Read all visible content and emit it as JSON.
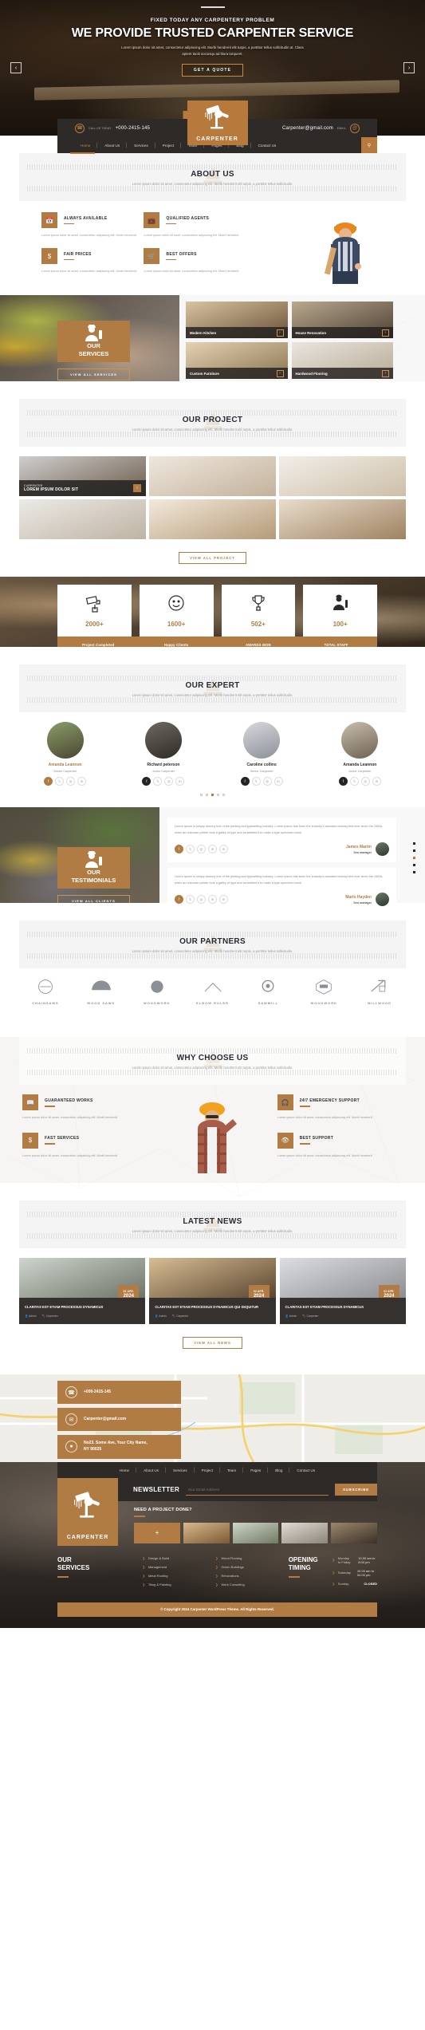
{
  "hero": {
    "subtitle": "FIXED TODAY ANY CARPENTERY PROBLEM",
    "title": "WE PROVIDE TRUSTED CARPENTER SERVICE",
    "description": "Lorem ipsum dolor sit amet, consectetur adipiscing elit. Morbi hendrerit elit turpis, a porttitor tellus sollicitudin at. Class aptent taciti sociosqu ad litora torquent.",
    "cta": "GET A QUOTE",
    "prev": "‹",
    "next": "›"
  },
  "topbar": {
    "phone_label": "CALL US TODAY",
    "phone": "+000-2415-145",
    "email": "Carpenter@gmail.com",
    "email_label": "EMAIL"
  },
  "logo": {
    "name": "CARPENTER"
  },
  "nav": {
    "items": [
      {
        "label": "Home",
        "active": true
      },
      {
        "label": "About Us",
        "active": false
      },
      {
        "label": "Services",
        "active": false
      },
      {
        "label": "Project",
        "active": false
      },
      {
        "label": "Team",
        "active": false
      },
      {
        "label": "Pages",
        "active": false
      },
      {
        "label": "Blog",
        "active": false
      },
      {
        "label": "Contact Us",
        "active": false
      }
    ],
    "search_icon": "search-icon"
  },
  "about": {
    "title": "ABOUT US",
    "subtitle": "Lorem ipsum dolor sit amet, consectetur adipiscing elit. Morbi hendrerit elit turpis, a porttitor tellus sollicitudin.",
    "features": [
      {
        "title": "ALWAYS AVAILABLE",
        "text": "Lorem ipsum dolor sit amet, consectetur adipiscing elit. Morbi hendrerit.",
        "icon": "calendar-icon"
      },
      {
        "title": "QUALIFIED AGENTS",
        "text": "Lorem ipsum dolor sit amet, consectetur adipiscing elit. Morbi hendrerit.",
        "icon": "briefcase-icon"
      },
      {
        "title": "FAIR PRICES",
        "text": "Lorem ipsum dolor sit amet, consectetur adipiscing elit. Morbi hendrerit.",
        "icon": "dollar-icon"
      },
      {
        "title": "BEST OFFERS",
        "text": "Lorem ipsum dolor sit amet, consectetur adipiscing elit. Morbi hendrerit.",
        "icon": "cart-icon"
      }
    ]
  },
  "services": {
    "card_line1": "OUR",
    "card_line2": "SERVICES",
    "button": "VIEW ALL SERVICES",
    "items": [
      {
        "title": "Modern Kitchen"
      },
      {
        "title": "House Renovation"
      },
      {
        "title": "Custom Furniture"
      },
      {
        "title": "Hardwood Flooring"
      }
    ]
  },
  "project": {
    "title": "OUR PROJECT",
    "subtitle": "Lorem ipsum dolor sit amet, consectetur adipiscing elit. Morbi hendrerit elit turpis, a porttitor tellus sollicitudin.",
    "featured_kicker": "CARPENTER",
    "featured_title": "LOREM IPSUM DOLOR SIT",
    "button": "VIEW ALL PROJECT"
  },
  "counters": [
    {
      "value": "2000+",
      "label": "Project Completed",
      "icon": "paint-roller-icon"
    },
    {
      "value": "1600+",
      "label": "Happy Clients",
      "icon": "smiley-icon"
    },
    {
      "value": "502+",
      "label": "AWARDS WON",
      "icon": "trophy-icon"
    },
    {
      "value": "100+",
      "label": "TOTAL STAFF",
      "icon": "worker-icon"
    }
  ],
  "team": {
    "title": "OUR EXPERT",
    "subtitle": "Lorem ipsum dolor sit amet, consectetur adipiscing elit. Morbi hendrerit elit turpis, a porttitor tellus sollicitudin.",
    "members": [
      {
        "name": "Amanda Leannon",
        "role": "Senior Carpenter",
        "highlight": true
      },
      {
        "name": "Richard peterson",
        "role": "Junior Carpenter",
        "highlight": false
      },
      {
        "name": "Caroline collins",
        "role": "Senior Carpenter",
        "highlight": false
      },
      {
        "name": "Amanda Leannon",
        "role": "Junior Carpenter",
        "highlight": false
      }
    ],
    "socials": [
      "f",
      "t",
      "i",
      "in"
    ],
    "dots": 5,
    "active_dot": 2
  },
  "testimonials": {
    "card_line1": "OUR",
    "card_line2": "TESTIMONIALS",
    "button": "VIEW ALL CLIENTS",
    "items": [
      {
        "text": "Lorem Ipsum is simply dummy text of the printing and typesetting industry. Lorem Ipsum has been the industry's standard dummy text ever since the 1500s, when an unknown printer took a galley of type and scrambled it to make a type specimen book.",
        "name": "James Martin",
        "role": "Seo manager"
      },
      {
        "text": "Lorem Ipsum is simply dummy text of the printing and typesetting industry. Lorem Ipsum has been the industry's standard dummy text ever since the 1500s, when an unknown printer took a galley of type and scrambled it to make a type specimen book.",
        "name": "Marlo Hayden",
        "role": "Seo manager"
      }
    ],
    "socials": [
      "f",
      "t",
      "i",
      "in",
      "in"
    ],
    "dots": 5,
    "active_dot": 2
  },
  "partners": {
    "title": "OUR PARTNERS",
    "subtitle": "Lorem ipsum dolor sit amet, consectetur adipiscing elit. Morbi hendrerit elit turpis, a porttitor tellus sollicitudin.",
    "logos": [
      "CHAINSAWS",
      "WOOD SAWS",
      "WOODWORK",
      "ELBOW RULER",
      "SAWMILL",
      "WOODWORK",
      "MILLWOOD"
    ]
  },
  "why": {
    "title": "WHY CHOOSE US",
    "subtitle": "Lorem ipsum dolor sit amet, consectetur adipiscing elit. Morbi hendrerit elit turpis, a porttitor tellus sollicitudin.",
    "left": [
      {
        "title": "GUARANTEED WORKS",
        "text": "Lorem ipsum dolor sit amet, consectetur adipiscing elit. Morbi hendrerit.",
        "icon": "book-icon"
      },
      {
        "title": "FAST SERVICES",
        "text": "Lorem ipsum dolor sit amet, consectetur adipiscing elit. Morbi hendrerit.",
        "icon": "dollar-icon"
      }
    ],
    "right": [
      {
        "title": "24/7 EMERGENCY SUPPORT",
        "text": "Lorem ipsum dolor sit amet, consectetur adipiscing elit. Morbi hendrerit.",
        "icon": "headset-icon"
      },
      {
        "title": "BEST SUPPORT",
        "text": "Lorem ipsum dolor sit amet, consectetur adipiscing elit. Morbi hendrerit.",
        "icon": "eye-icon"
      }
    ]
  },
  "news": {
    "title": "LATEST NEWS",
    "subtitle": "Lorem ipsum dolor sit amet, consectetur adipiscing elit. Morbi hendrerit elit turpis, a porttitor tellus sollicitudin.",
    "button": "VIEW ALL NEWS",
    "items": [
      {
        "day": "02 APR.",
        "year": "2024",
        "title": "CLARITAS EST ETIAM PROCESSUS DYNAMICUS",
        "meta1": "Admin",
        "meta2": "Carpenter"
      },
      {
        "day": "02 APR.",
        "year": "2024",
        "title": "CLARITAS EST ETIAM PROCESSUS DYNAMICUS QUI SEQUITUR",
        "meta1": "Admin",
        "meta2": "Carpenter"
      },
      {
        "day": "02 APR.",
        "year": "2024",
        "title": "CLARITAS EST ETIAM PROCESSUS DYNAMICUS",
        "meta1": "Admin",
        "meta2": "Carpenter"
      }
    ]
  },
  "contact": {
    "phone": "+000-2415-145",
    "email": "Carpenter@gmail.com",
    "address_line1": "No23. Some Ave, Your City Name,",
    "address_line2": "NY 90025",
    "phone_icon": "phone-icon",
    "email_icon": "envelope-icon",
    "location_icon": "location-pin-icon"
  },
  "footer": {
    "nav": [
      "Home",
      "About Us",
      "Services",
      "Project",
      "Team",
      "Pages",
      "Blog",
      "Contact Us"
    ],
    "newsletter_label": "NEWSLETTER",
    "newsletter_placeholder": "Your Email Address",
    "subscribe": "SUBSCRIBE",
    "project_heading": "NEED A PROJECT DONE?",
    "logo_name": "CARPENTER",
    "services_title_line1": "OUR",
    "services_title_line2": "SERVICES",
    "services_col1": [
      "Design & Build",
      "Management",
      "Metal Roofing",
      "Tiling & Painting"
    ],
    "services_col2": [
      "Wood Flooring",
      "Green Buildings",
      "Renovations",
      "Work Consulting"
    ],
    "timing_title_line1": "OPENING",
    "timing_title_line2": "TIMING",
    "timing": [
      {
        "day": "Monday to Friday",
        "hours": "10.00 am to  8.00 pm",
        "closed": false
      },
      {
        "day": "Saturday",
        "hours": "10.00 am to 04.00 pm",
        "closed": false
      },
      {
        "day": "Sunday",
        "hours": "CLOSED",
        "closed": true
      }
    ],
    "copyright": "© Copyright 2024 Carpenter WordPress Theme. All Rights Reserved."
  }
}
